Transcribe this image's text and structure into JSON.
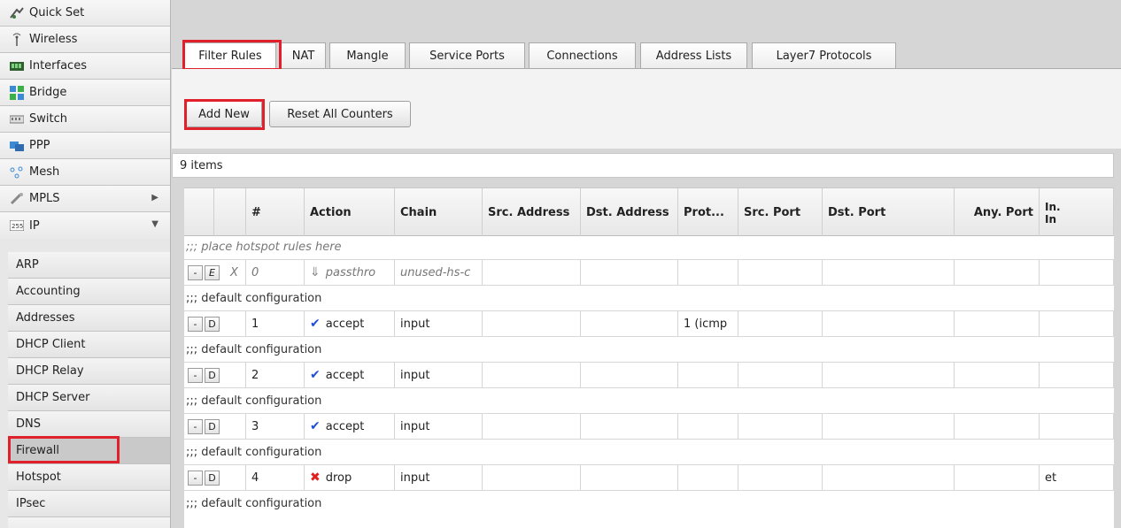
{
  "sidebar": {
    "items": [
      {
        "label": "Quick Set",
        "icon": "quick-set-icon"
      },
      {
        "label": "Wireless",
        "icon": "wireless-icon"
      },
      {
        "label": "Interfaces",
        "icon": "interfaces-icon"
      },
      {
        "label": "Bridge",
        "icon": "bridge-icon"
      },
      {
        "label": "Switch",
        "icon": "switch-icon"
      },
      {
        "label": "PPP",
        "icon": "ppp-icon"
      },
      {
        "label": "Mesh",
        "icon": "mesh-icon"
      },
      {
        "label": "MPLS",
        "icon": "mpls-icon",
        "arrow": "▶"
      },
      {
        "label": "IP",
        "icon": "ip-icon",
        "arrow": "▼"
      }
    ],
    "subitems": [
      {
        "label": "ARP"
      },
      {
        "label": "Accounting"
      },
      {
        "label": "Addresses"
      },
      {
        "label": "DHCP Client"
      },
      {
        "label": "DHCP Relay"
      },
      {
        "label": "DHCP Server"
      },
      {
        "label": "DNS"
      },
      {
        "label": "Firewall"
      },
      {
        "label": "Hotspot"
      },
      {
        "label": "IPsec"
      }
    ]
  },
  "tabs": [
    {
      "label": "Filter Rules"
    },
    {
      "label": "NAT"
    },
    {
      "label": "Mangle"
    },
    {
      "label": "Service Ports"
    },
    {
      "label": "Connections"
    },
    {
      "label": "Address Lists"
    },
    {
      "label": "Layer7 Protocols"
    }
  ],
  "toolbar": {
    "add_new": "Add New",
    "reset_counters": "Reset All Counters"
  },
  "list": {
    "count_label": "9 items"
  },
  "table": {
    "headers": {
      "num": "#",
      "action": "Action",
      "chain": "Chain",
      "src_address": "Src. Address",
      "dst_address": "Dst. Address",
      "protocol": "Prot...",
      "src_port": "Src. Port",
      "dst_port": "Dst. Port",
      "any_port": "Any. Port",
      "in_interface": "In. In"
    },
    "comments": [
      ";;; place hotspot rules here",
      ";;; default configuration",
      ";;; default configuration",
      ";;; default configuration",
      ";;; default configuration",
      ";;; default configuration"
    ],
    "rows": [
      {
        "btn1": "-",
        "btn2": "E",
        "flag": "X",
        "num": "0",
        "action": "passthro",
        "chain": "unused-hs-c",
        "protocol": "",
        "in_interface": ""
      },
      {
        "btn1": "-",
        "btn2": "D",
        "flag": "",
        "num": "1",
        "action": "accept",
        "chain": "input",
        "protocol": "1 (icmp",
        "in_interface": ""
      },
      {
        "btn1": "-",
        "btn2": "D",
        "flag": "",
        "num": "2",
        "action": "accept",
        "chain": "input",
        "protocol": "",
        "in_interface": ""
      },
      {
        "btn1": "-",
        "btn2": "D",
        "flag": "",
        "num": "3",
        "action": "accept",
        "chain": "input",
        "protocol": "",
        "in_interface": ""
      },
      {
        "btn1": "-",
        "btn2": "D",
        "flag": "",
        "num": "4",
        "action": "drop",
        "chain": "input",
        "protocol": "",
        "in_interface": "et"
      }
    ]
  },
  "colors": {
    "highlight": "#e0202a",
    "accept_check": "#1e4fd6",
    "drop_x": "#e02020"
  }
}
